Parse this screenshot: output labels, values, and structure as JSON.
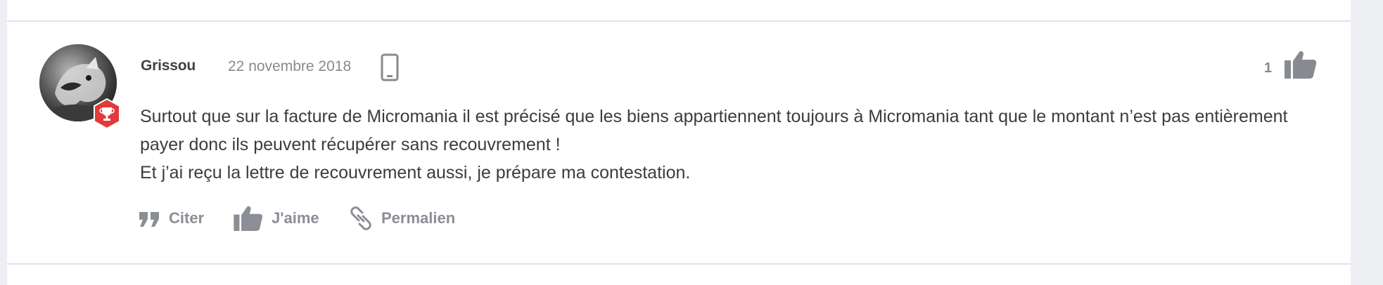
{
  "post": {
    "author": "Grissou",
    "date": "22 novembre 2018",
    "device_icon": "mobile-phone-icon",
    "rank_badge_icon": "trophy-badge-icon",
    "like_count": "1",
    "body_lines": [
      "Surtout que sur la facture de Micromania il est précisé que les biens appartiennent toujours à Micromania tant que le montant n’est pas entièrement payer donc ils peuvent récupérer sans recouvrement !",
      "Et j’ai reçu la lettre de recouvrement aussi, je prépare ma contestation."
    ]
  },
  "actions": {
    "quote_label": "Citer",
    "like_label": "J'aime",
    "permalink_label": "Permalien"
  },
  "colors": {
    "badge_red": "#e23a3a",
    "muted_text": "#878a90",
    "body_text": "#3a3c40",
    "gutter": "#eeeff2"
  }
}
